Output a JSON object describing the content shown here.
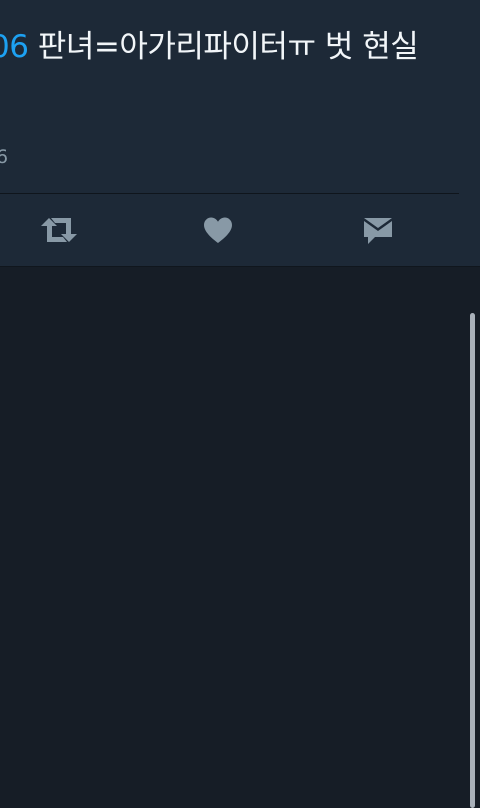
{
  "tweet": {
    "text_mention": "06",
    "text_body": " 판녀=아가리파이터ㅠ 벗 현실",
    "meta": "6"
  },
  "actions": [
    {
      "icon": "retweet-icon",
      "label": "Retweet"
    },
    {
      "icon": "heart-icon",
      "label": "Like"
    },
    {
      "icon": "direct-message-icon",
      "label": "Message"
    }
  ],
  "colors": {
    "background": "#161d26",
    "card": "#1d2937",
    "mention": "#1da1f2",
    "icon": "#8899a6"
  }
}
